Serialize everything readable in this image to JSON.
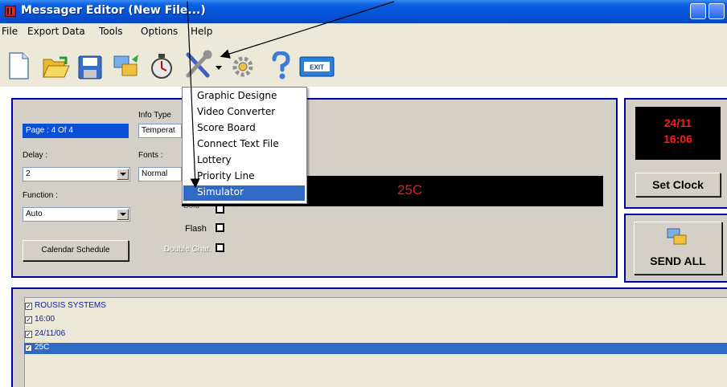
{
  "window": {
    "title": "Messager Editor  (New File...)"
  },
  "menubar": [
    "File",
    "Export Data",
    "Tools",
    "Options",
    "Help"
  ],
  "toolbar": {
    "icons": [
      "new-file-icon",
      "open-folder-icon",
      "save-disk-icon",
      "messenger-icon",
      "timer-icon",
      "tools-icon",
      "dropdown-arrow-icon",
      "settings-gear-icon",
      "help-icon",
      "exit-icon"
    ],
    "exit_label": "EXIT"
  },
  "tools_menu": {
    "items": [
      "Graphic Designe",
      "Video Converter",
      "Score Board",
      "Connect Text File",
      "Lottery",
      "Priority Line",
      "Simulator"
    ],
    "selected": "Simulator"
  },
  "editor": {
    "page": "Page : 4 Of 4",
    "info_type_label": "Info Type",
    "info_type_value": "Temperat",
    "delay_label": "Delay :",
    "delay_value": "2",
    "fonts_label": "Fonts :",
    "fonts_value": "Normal",
    "function_label": "Function :",
    "function_value": "Auto",
    "bold_label": "Bold",
    "flash_label": "Flash",
    "double_char_label": "Double Char.",
    "calendar_button": "Calendar Schedule",
    "display_text": "25C"
  },
  "clock": {
    "date": "24/11",
    "time": "16:06",
    "set_clock_label": "Set Clock"
  },
  "send": {
    "send_all_label": "SEND ALL"
  },
  "messages": [
    {
      "text": "ROUSIS SYSTEMS",
      "checked": true,
      "selected": false
    },
    {
      "text": "16:00",
      "checked": true,
      "selected": false
    },
    {
      "text": "24/11/06",
      "checked": true,
      "selected": false
    },
    {
      "text": "25C",
      "checked": true,
      "selected": true
    }
  ],
  "colors": {
    "panel_border": "#0000a8",
    "led_red": "#ff1a1a",
    "selection": "#316ac5"
  }
}
